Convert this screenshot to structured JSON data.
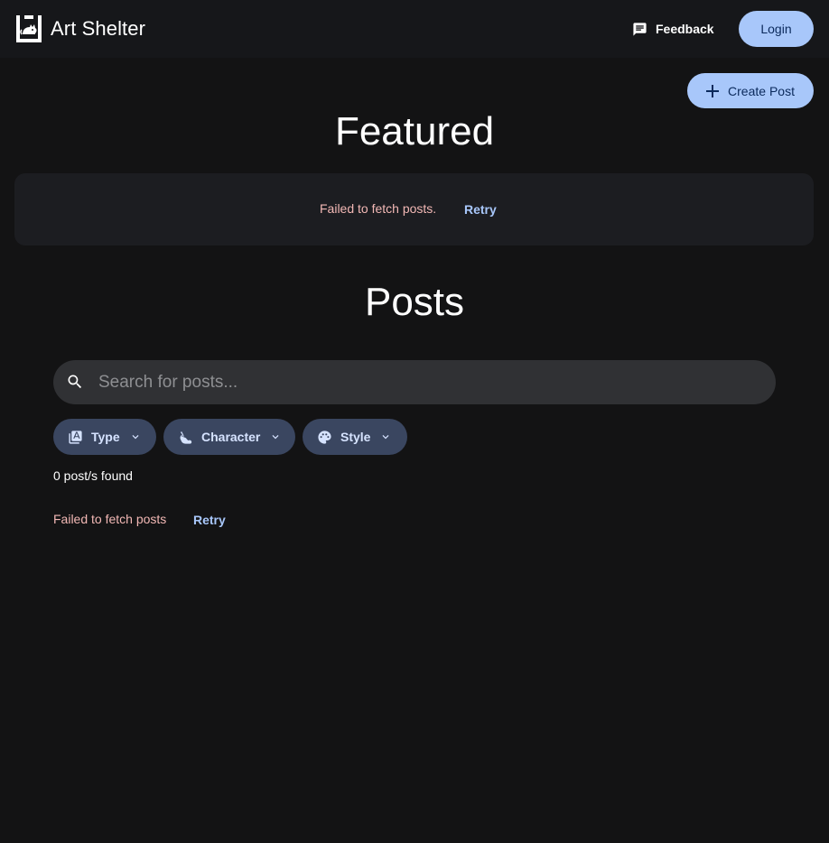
{
  "header": {
    "app_name": "Art Shelter",
    "logo_icon": "cat-shelter-logo-icon",
    "feedback_label": "Feedback",
    "feedback_icon": "feedback-icon",
    "login_label": "Login"
  },
  "actions": {
    "create_post_label": "Create Post",
    "create_post_icon": "plus-icon"
  },
  "featured": {
    "title": "Featured",
    "error_text": "Failed to fetch posts.",
    "retry_label": "Retry"
  },
  "posts": {
    "title": "Posts",
    "search": {
      "placeholder": "Search for posts...",
      "value": "",
      "icon": "search-icon"
    },
    "filters": [
      {
        "label": "Type",
        "icon": "type-icon"
      },
      {
        "label": "Character",
        "icon": "character-icon"
      },
      {
        "label": "Style",
        "icon": "palette-icon"
      }
    ],
    "count_text": "0 post/s found",
    "error_text": "Failed to fetch posts",
    "retry_label": "Retry"
  },
  "colors": {
    "background": "#131314",
    "header_bg": "#16171a",
    "panel_bg": "#1c1d21",
    "accent": "#a8c7fa",
    "error": "#f2b8b5",
    "chip_bg": "#3a4660"
  }
}
